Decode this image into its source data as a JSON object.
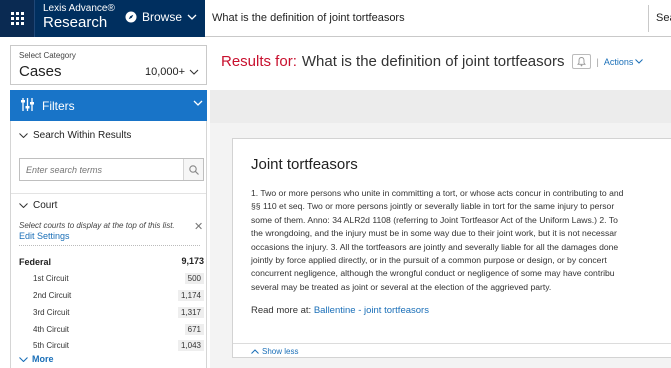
{
  "header": {
    "brand_line1": "Lexis Advance®",
    "brand_line2": "Research",
    "browse_label": "Browse",
    "search_query": "What is the definition of joint tortfeasors",
    "search_button": "Sea"
  },
  "category": {
    "label": "Select Category",
    "value": "Cases",
    "count": "10,000+"
  },
  "filters": {
    "title": "Filters",
    "search_within": "Search Within Results",
    "search_placeholder": "Enter search terms",
    "court_heading": "Court",
    "court_note": "Select courts to display at the top of this list.",
    "edit_settings": "Edit Settings",
    "federal_label": "Federal",
    "federal_count": "9,173",
    "courts": [
      {
        "label": "1st Circuit",
        "count": "500"
      },
      {
        "label": "2nd Circuit",
        "count": "1,174"
      },
      {
        "label": "3rd Circuit",
        "count": "1,317"
      },
      {
        "label": "4th Circuit",
        "count": "671"
      },
      {
        "label": "5th Circuit",
        "count": "1,043"
      }
    ],
    "more_label": "More"
  },
  "results": {
    "prefix": "Results for:",
    "query": "What is the definition of joint tortfeasors",
    "pipe": "|",
    "actions_label": "Actions"
  },
  "definition": {
    "title": "Joint tortfeasors",
    "body_lines": [
      "1. Two or more persons who unite in committing a tort, or whose acts concur in contributing to and",
      "§§ 110 et seq. Two or more persons jointly or severally liable in tort for the same injury to persor",
      "some of them. Anno: 34 ALR2d 1108 (referring to Joint Tortfeasor Act of the Uniform Laws.) 2. To",
      "the wrongdoing, and the injury must be in some way due to their joint work, but it is not necessar",
      "occasions the injury. 3. All the tortfeasors are jointly and severally liable for all the damages done",
      "jointly by force applied directly, or in the pursuit of a common purpose or design, or by concert",
      "concurrent negligence, although the wrongful conduct or negligence of some may have contribu",
      "several may be treated as joint or several at the election of the aggrieved party."
    ],
    "read_more_prefix": "Read more at:",
    "read_more_link": "Ballentine - joint tortfeasors",
    "show_less": "Show less"
  },
  "colors": {
    "navy": "#002f5f",
    "filter_blue": "#1874c8",
    "link_blue": "#1a6fb8",
    "results_red": "#c8102e"
  },
  "icons": [
    "apps-grid-icon",
    "compass-icon",
    "chevron-down-icon",
    "filter-sliders-icon",
    "search-icon",
    "close-icon",
    "bell-icon",
    "chevron-up-icon"
  ]
}
